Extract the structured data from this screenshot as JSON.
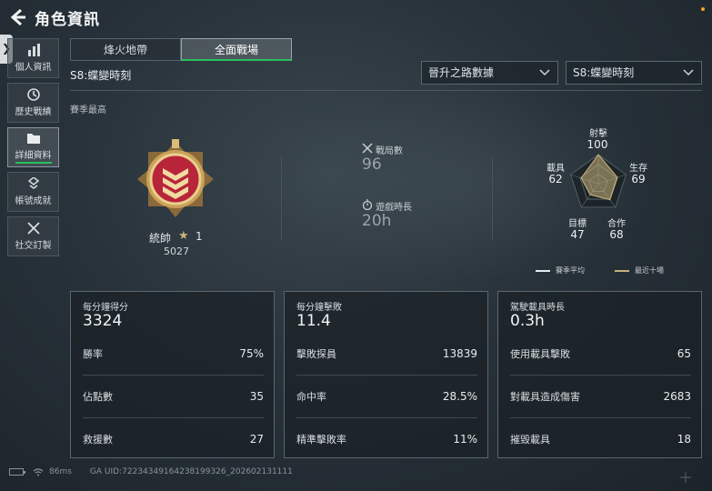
{
  "header": {
    "title": "角色資訊"
  },
  "sidebar": {
    "items": [
      {
        "label": "個人資訊",
        "icon": "bar-chart-icon"
      },
      {
        "label": "歷史戰績",
        "icon": "history-icon"
      },
      {
        "label": "詳細資料",
        "icon": "folder-icon",
        "active": true
      },
      {
        "label": "帳號成就",
        "icon": "medal-icon"
      },
      {
        "label": "社交訂製",
        "icon": "tools-icon"
      }
    ]
  },
  "tabs": [
    {
      "label": "烽火地帶",
      "active": false
    },
    {
      "label": "全面戰場",
      "active": true
    }
  ],
  "season_label": "S8:蝶變時刻",
  "filters": {
    "data_type": "晉升之路數據",
    "season": "S8:蝶變時刻"
  },
  "season_best_label": "賽季最高",
  "rank": {
    "name": "統帥",
    "star_count": "1",
    "points": "5027"
  },
  "middle_stats": {
    "matches_label": "戰局數",
    "matches_value": "96",
    "playtime_label": "遊戲時長",
    "playtime_value": "20h"
  },
  "radar": {
    "axes": [
      {
        "label": "射擊",
        "value": "100",
        "score": 100
      },
      {
        "label": "生存",
        "value": "69",
        "score": 69
      },
      {
        "label": "合作",
        "value": "68",
        "score": 68
      },
      {
        "label": "目標",
        "value": "47",
        "score": 47
      },
      {
        "label": "載具",
        "value": "62",
        "score": 62
      }
    ],
    "legend": [
      {
        "label": "賽季平均",
        "color": "#e6eaec"
      },
      {
        "label": "最近十場",
        "color": "#c9b37a"
      }
    ]
  },
  "cards": [
    {
      "title": "每分鐘得分",
      "big_value": "3324",
      "rows": [
        {
          "label": "勝率",
          "value": "75%"
        },
        {
          "label": "佔點數",
          "value": "35"
        },
        {
          "label": "救援數",
          "value": "27"
        }
      ]
    },
    {
      "title": "每分鐘擊敗",
      "big_value": "11.4",
      "rows": [
        {
          "label": "擊敗探員",
          "value": "13839"
        },
        {
          "label": "命中率",
          "value": "28.5%"
        },
        {
          "label": "精準擊敗率",
          "value": "11%"
        }
      ]
    },
    {
      "title": "駕駛載具時長",
      "big_value": "0.3h",
      "rows": [
        {
          "label": "使用載具擊敗",
          "value": "65"
        },
        {
          "label": "對載具造成傷害",
          "value": "2683"
        },
        {
          "label": "摧毀載具",
          "value": "18"
        }
      ]
    }
  ],
  "footer": {
    "ping": "86ms",
    "uid": "GA UID:72234349164238199326_202602131111"
  },
  "colors": {
    "accent_green": "#27c15a",
    "gold": "#c9b37a",
    "notification_dot": "#f0a030"
  }
}
